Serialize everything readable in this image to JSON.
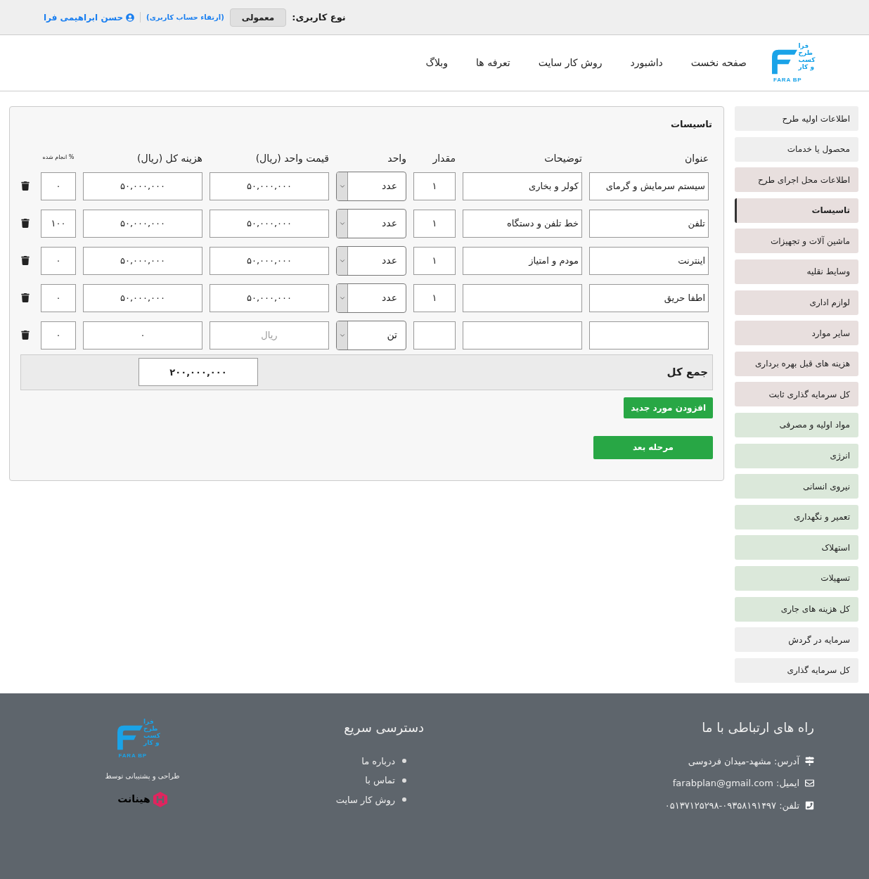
{
  "top_bar": {
    "user_type_label": "نوع کاربری:",
    "user_type": "معمولی",
    "upgrade_link": "(ارتقاء حساب کاربری)",
    "user_name": "حسن ابراهیمی فرا"
  },
  "logo": {
    "lines": [
      "فرا",
      "طرح",
      "کسب",
      "و کار"
    ],
    "latin": "FARA BP"
  },
  "nav": [
    {
      "label": "صفحه نخست"
    },
    {
      "label": "داشبورد"
    },
    {
      "label": "روش کار سایت"
    },
    {
      "label": "تعرفه ها"
    },
    {
      "label": "وبلاگ"
    }
  ],
  "sidebar": [
    {
      "label": "اطلاعات اولیه طرح",
      "color": "#efefef",
      "selected": false
    },
    {
      "label": "محصول یا خدمات",
      "color": "#efefef",
      "selected": false
    },
    {
      "label": "اطلاعات محل اجرای طرح",
      "color": "#e8dfde",
      "selected": false
    },
    {
      "label": "تاسیسات",
      "color": "#e8dfde",
      "selected": true
    },
    {
      "label": "ماشین آلات و تجهیزات",
      "color": "#e8dfde",
      "selected": false
    },
    {
      "label": "وسایط نقلیه",
      "color": "#e8dfde",
      "selected": false
    },
    {
      "label": "لوازم اداری",
      "color": "#e8dfde",
      "selected": false
    },
    {
      "label": "سایر موارد",
      "color": "#e8dfde",
      "selected": false
    },
    {
      "label": "هزینه های قبل بهره برداری",
      "color": "#e8dfde",
      "selected": false
    },
    {
      "label": "کل سرمایه گذاری ثابت",
      "color": "#e8dfde",
      "selected": false
    },
    {
      "label": "مواد اولیه و مصرفی",
      "color": "#dbe8da",
      "selected": false
    },
    {
      "label": "انرژی",
      "color": "#dbe8da",
      "selected": false
    },
    {
      "label": "نیروی انسانی",
      "color": "#dbe8da",
      "selected": false
    },
    {
      "label": "تعمیر و نگهداری",
      "color": "#dbe8da",
      "selected": false
    },
    {
      "label": "استهلاک",
      "color": "#dbe8da",
      "selected": false
    },
    {
      "label": "تسهیلات",
      "color": "#dbe8da",
      "selected": false
    },
    {
      "label": "کل هزینه های جاری",
      "color": "#dbe8da",
      "selected": false
    },
    {
      "label": "سرمایه در گردش",
      "color": "#efefef",
      "selected": false
    },
    {
      "label": "کل سرمایه گذاری",
      "color": "#efefef",
      "selected": false
    }
  ],
  "form": {
    "title": "تاسیسات",
    "columns": [
      "عنوان",
      "توضیحات",
      "مقدار",
      "واحد",
      "قیمت واحد (ریال)",
      "هزینه کل (ریال)",
      "% انجام شده"
    ],
    "rows": [
      {
        "title": "سیستم سرمایش و گرمای",
        "description": "کولر و بخاری",
        "quantity": "۱",
        "unit": "عدد",
        "unit_price": "۵۰,۰۰۰,۰۰۰",
        "total": "۵۰,۰۰۰,۰۰۰",
        "percent": "۰"
      },
      {
        "title": "تلفن",
        "description": "خط تلفن و دستگاه",
        "quantity": "۱",
        "unit": "عدد",
        "unit_price": "۵۰,۰۰۰,۰۰۰",
        "total": "۵۰,۰۰۰,۰۰۰",
        "percent": "۱۰۰"
      },
      {
        "title": "اینترنت",
        "description": "مودم و امتیاز",
        "quantity": "۱",
        "unit": "عدد",
        "unit_price": "۵۰,۰۰۰,۰۰۰",
        "total": "۵۰,۰۰۰,۰۰۰",
        "percent": "۰"
      },
      {
        "title": "اطفا حریق",
        "quantity": "۱",
        "unit": "عدد",
        "unit_price": "۵۰,۰۰۰,۰۰۰",
        "total": "۵۰,۰۰۰,۰۰۰",
        "percent": "۰"
      },
      {
        "unit": "تن",
        "unit_price_placeholder": "ریال",
        "total": "۰",
        "percent": "۰"
      }
    ],
    "total_label": "جمع کل",
    "total_value": "۲۰۰,۰۰۰,۰۰۰",
    "add_button": "افزودن مورد جدید",
    "next_button": "مرحله بعد"
  },
  "footer": {
    "contact_title": "راه های ارتباطی با ما",
    "contacts": [
      {
        "kind": "address",
        "text": "آدرس: مشهد-میدان فردوسی"
      },
      {
        "kind": "email",
        "text": "ایمیل: farabplan@gmail.com"
      },
      {
        "kind": "phone",
        "text": "تلفن: ۰۹۳۵۸۱۹۱۴۹۷-۰۵۱۳۷۱۲۵۲۹۸"
      }
    ],
    "links_title": "دسترسی سریع",
    "links": [
      "درباره ما",
      "تماس با",
      "روش کار سایت"
    ],
    "logo": {
      "lines": [
        "فرا",
        "طرح",
        "کسب",
        "و کار"
      ],
      "latin": "FARA BP"
    },
    "credit": "طراحی و پشتیبانی توسط",
    "designer": "هینانت"
  }
}
